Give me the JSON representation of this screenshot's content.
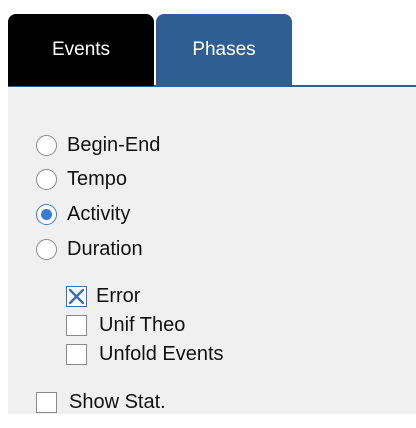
{
  "tabs": [
    {
      "label": "Events",
      "active": false
    },
    {
      "label": "Phases",
      "active": true
    }
  ],
  "mode_options": [
    {
      "label": "Begin-End",
      "selected": false
    },
    {
      "label": "Tempo",
      "selected": false
    },
    {
      "label": "Activity",
      "selected": true
    },
    {
      "label": "Duration",
      "selected": false
    }
  ],
  "sub_options": [
    {
      "label": "Error",
      "checked": true
    },
    {
      "label": "Unif Theo",
      "checked": false
    },
    {
      "label": "Unfold Events",
      "checked": false
    }
  ],
  "show_stat": {
    "label": "Show Stat.",
    "checked": false
  },
  "colors": {
    "events_tab": "#000000",
    "phases_tab": "#2f5e93",
    "radio_selected": "#3a7bd5",
    "check_mark": "#3a6fb0",
    "content_bg": "#f0f0f0"
  }
}
